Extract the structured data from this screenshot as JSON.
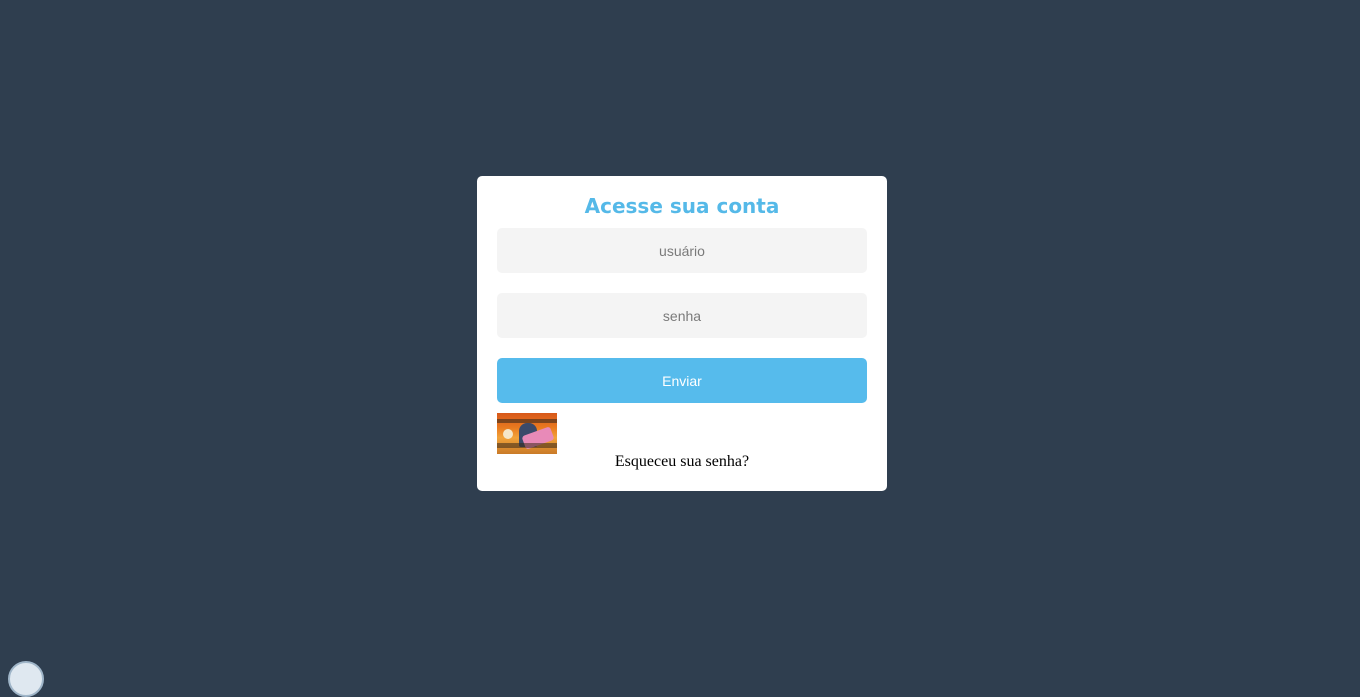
{
  "login": {
    "title": "Acesse sua conta",
    "username_placeholder": "usuário",
    "password_placeholder": "senha",
    "submit_label": "Enviar",
    "forgot_label": "Esqueceu sua senha?"
  },
  "colors": {
    "background": "#2f3e4f",
    "card": "#ffffff",
    "accent": "#55b9e8",
    "button": "#56bbec",
    "input_bg": "#f4f4f4"
  }
}
